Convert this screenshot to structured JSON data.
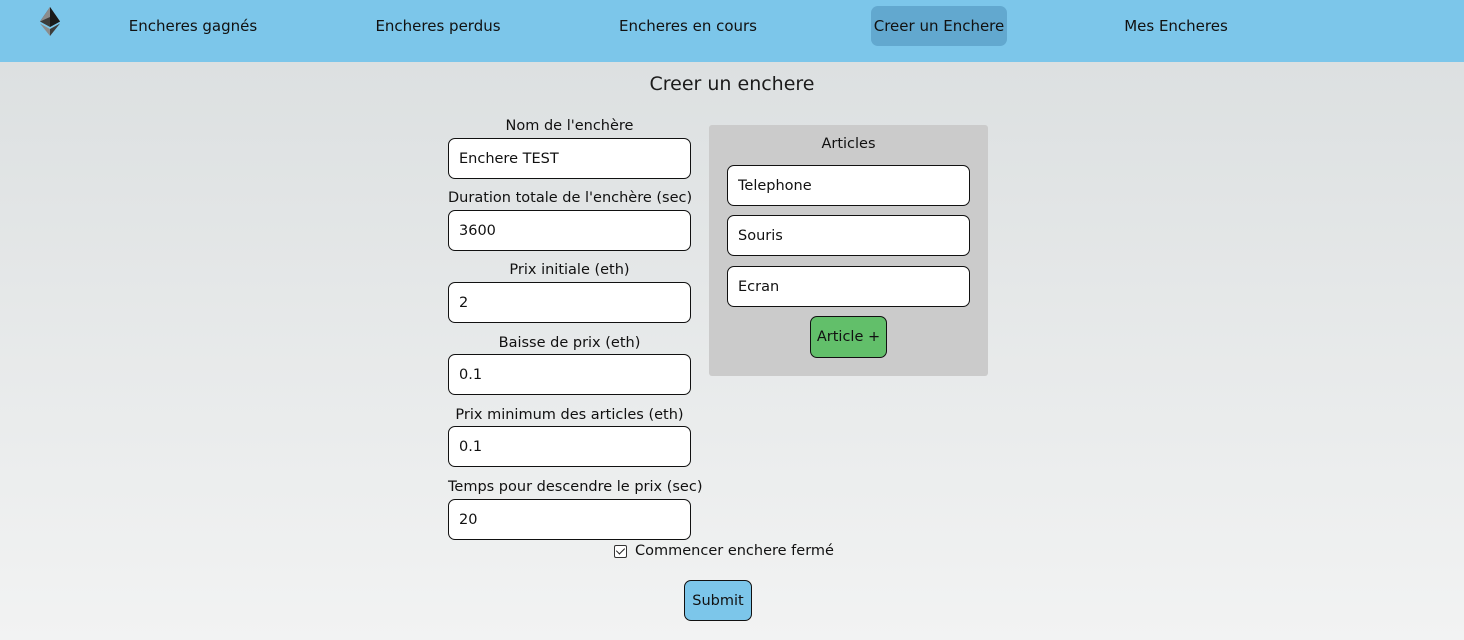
{
  "nav": {
    "logo_icon": "ethereum-icon",
    "items": [
      {
        "label": "Encheres gagnés",
        "active": false
      },
      {
        "label": "Encheres perdus",
        "active": false
      },
      {
        "label": "Encheres en cours",
        "active": false
      },
      {
        "label": "Creer un Enchere",
        "active": true
      },
      {
        "label": "Mes Encheres",
        "active": false
      }
    ]
  },
  "page": {
    "title": "Creer un enchere"
  },
  "form": {
    "fields": [
      {
        "label": "Nom de l'enchère",
        "value": "Enchere TEST"
      },
      {
        "label": "Duration totale de l'enchère (sec)",
        "value": "3600"
      },
      {
        "label": "Prix initiale (eth)",
        "value": "2"
      },
      {
        "label": "Baisse de prix (eth)",
        "value": "0.1"
      },
      {
        "label": "Prix minimum des articles (eth)",
        "value": "0.1"
      },
      {
        "label": "Temps pour descendre le prix (sec)",
        "value": "20"
      }
    ],
    "checkbox": {
      "label": "Commencer enchere fermé",
      "checked": true
    },
    "submit_label": "Submit"
  },
  "articles": {
    "title": "Articles",
    "items": [
      "Telephone",
      "Souris",
      "Ecran"
    ],
    "add_label": "Article +"
  },
  "colors": {
    "navbar": "#7cc6ea",
    "nav_active": "#62a8cf",
    "add_button": "#62bf6a",
    "submit_button": "#7cc6ea",
    "articles_panel": "#cbcbcb"
  }
}
